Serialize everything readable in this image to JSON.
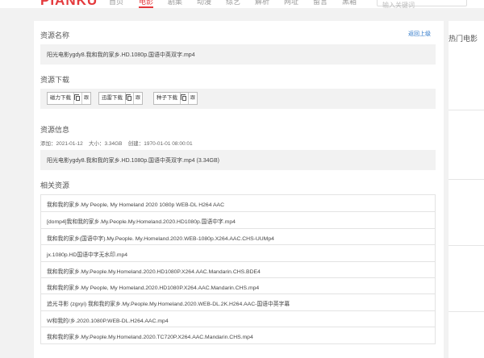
{
  "header": {
    "logo": "PIANKU",
    "nav": [
      {
        "label": "首页",
        "active": false
      },
      {
        "label": "电影",
        "active": true
      },
      {
        "label": "剧集",
        "active": false
      },
      {
        "label": "动漫",
        "active": false
      },
      {
        "label": "综艺",
        "active": false
      },
      {
        "label": "解析",
        "active": false
      },
      {
        "label": "网址",
        "active": false
      },
      {
        "label": "留言",
        "active": false
      },
      {
        "label": "黑箱",
        "active": false
      }
    ],
    "search_placeholder": "输入关键词"
  },
  "resource": {
    "name_heading": "资源名称",
    "back_link": "返回上级",
    "filename": "阳光电影ygdy8.我和我的家乡.HD.1080p.国语中英双字.mp4",
    "download_heading": "资源下载",
    "downloads": [
      {
        "label": "磁力下载",
        "qr": "跟"
      },
      {
        "label": "迅雷下载",
        "qr": "跟"
      },
      {
        "label": "种子下载",
        "qr": "跟"
      }
    ],
    "info_heading": "资源信息",
    "meta": "添加：2021-01-12    大小：3.34GB    创建：1970-01-01 08:00:01",
    "info_text": "阳光电影ygdy8.我和我的家乡.HD.1080p.国语中英双字.mp4 (3.34GB)",
    "related_heading": "相关资源",
    "related": [
      "我和我的家乡.My People, My Homeland 2020 1080p WEB-DL H264 AAC",
      "[domp4]我和我的家乡.My.People.My.Homeland.2020.HD1080p.国语中字.mp4",
      "我和我的家乡(国语中字).My.People. My.Homeland.2020.WEB-1080p.X264.AAC.CHS-UUMp4",
      "jx.1080p.HD国语中字无水印.mp4",
      "我和我的家乡.My.People.My.Homeland.2020.HD1080P.X264.AAC.Mandarin.CHS.BDE4",
      "我和我的家乡.My People, My Homeland.2020.HD1080P.X264.AAC.Mandarin.CHS.mp4",
      "追光寻影 (zgxyi) 我和我的家乡.My.People.My.Homeland.2020.WEB-DL.2K.H264.AAC-国语中英字幕",
      "W和我的/乡.2020.1080P.WEB-DL.H264.AAC.mp4",
      "我和我的家乡.My.People.My.Homeland.2020.TC720P.X264.AAC.Mandarin.CHS.mp4"
    ]
  },
  "sidebar": {
    "title": "热门电影"
  }
}
